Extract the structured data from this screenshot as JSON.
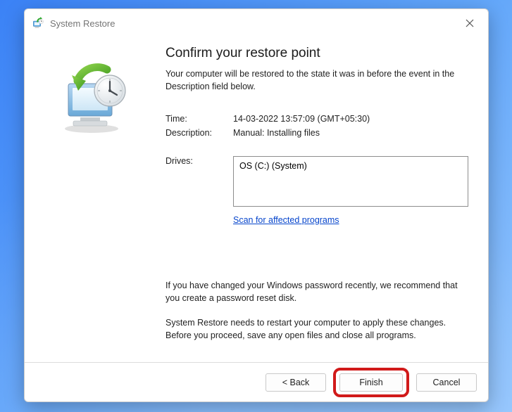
{
  "window": {
    "title": "System Restore",
    "close_label": "Close"
  },
  "heading": "Confirm your restore point",
  "subtext": "Your computer will be restored to the state it was in before the event in the Description field below.",
  "fields": {
    "time_label": "Time:",
    "time_value": "14-03-2022 13:57:09 (GMT+05:30)",
    "description_label": "Description:",
    "description_value": "Manual: Installing files",
    "drives_label": "Drives:",
    "drives_value": "OS (C:) (System)"
  },
  "scan_link": "Scan for affected programs",
  "notices": {
    "password": "If you have changed your Windows password recently, we recommend that you create a password reset disk.",
    "restart": "System Restore needs to restart your computer to apply these changes. Before you proceed, save any open files and close all programs."
  },
  "buttons": {
    "back": "< Back",
    "finish": "Finish",
    "cancel": "Cancel"
  }
}
